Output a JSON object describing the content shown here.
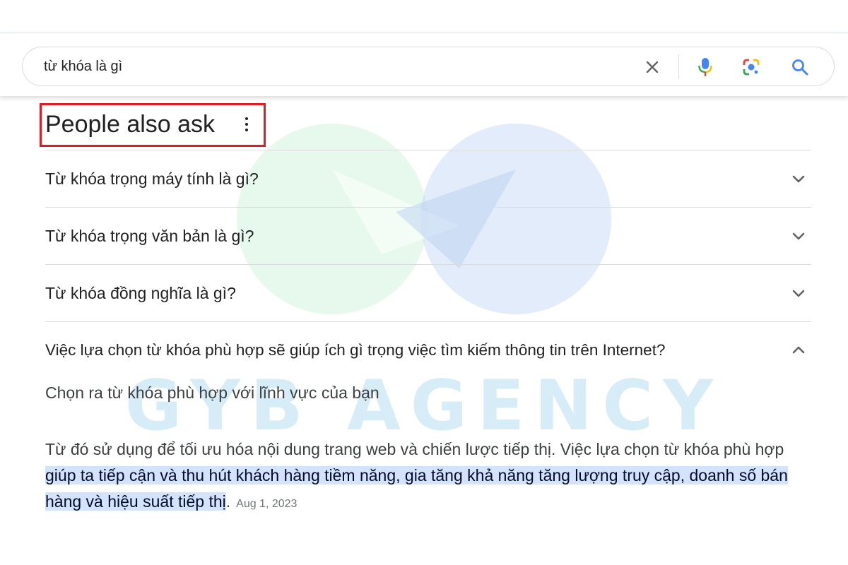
{
  "search": {
    "query": "từ khóa là gì"
  },
  "icons": {
    "clear": "close-icon",
    "voice": "microphone-icon",
    "lens": "camera-lens-icon",
    "search": "search-icon",
    "more": "more-vert-icon",
    "expand": "chevron-down-icon",
    "collapse": "chevron-up-icon"
  },
  "people_also_ask": {
    "title": "People also ask",
    "questions": [
      {
        "text": "Từ khóa trọng máy tính là gì?",
        "expanded": false
      },
      {
        "text": "Từ khóa trọng văn bản là gì?",
        "expanded": false
      },
      {
        "text": "Từ khóa đồng nghĩa là gì?",
        "expanded": false
      },
      {
        "text": "Việc lựa chọn từ khóa phù hợp sẽ giúp ích gì trọng việc tìm kiếm thông tin trên Internet?",
        "expanded": true
      }
    ],
    "answer": {
      "heading": "Chọn ra từ khóa phù hợp với lĩnh vực của bạn",
      "text_plain": "Từ đó sử dụng để tối ưu hóa nội dung trang web và chiến lược tiếp thị. Việc lựa chọn từ khóa phù hợp ",
      "text_highlight": "giúp ta tiếp cận và thu hút khách hàng tiềm năng, gia tăng khả năng tăng lượng truy cập, doanh số bán hàng và hiệu suất tiếp thị",
      "text_end": ".",
      "date": "Aug 1, 2023"
    }
  },
  "watermark": {
    "text": "GYB AGENCY"
  },
  "colors": {
    "highlight_frame": "#e01b24",
    "answer_highlight": "#d3e3fd",
    "search_blue": "#4285f4",
    "mic_red": "#ea4335",
    "mic_yellow": "#fbbc04",
    "lens_green": "#34a853"
  }
}
